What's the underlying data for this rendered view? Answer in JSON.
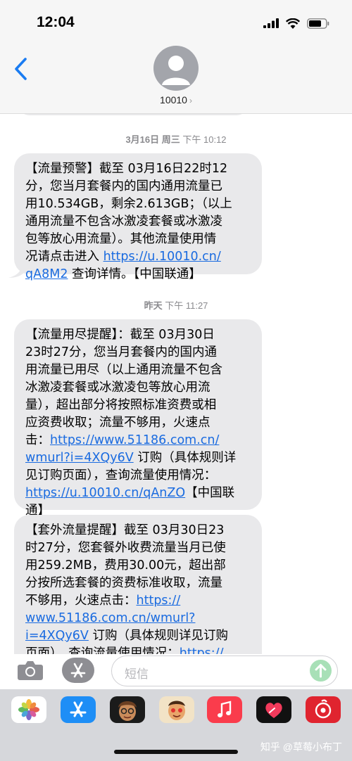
{
  "status_bar": {
    "time": "12:04"
  },
  "header": {
    "contact": "10010",
    "chevron": "›"
  },
  "thread": {
    "timestamps": [
      {
        "date": "3月16日 周三",
        "time": "下午 10:12"
      },
      {
        "date": "昨天",
        "time": "下午 11:27"
      }
    ],
    "messages": [
      {
        "lines": [
          "【流量预警】截至 03月16日22时12",
          "分，您当月套餐内的国内通用流量已",
          "用10.534GB，剩余2.613GB；（以上",
          "通用流量不包含冰激凌套餐或冰激凌",
          "包等放心用流量）。其他流量使用情",
          "况请点击进入 "
        ],
        "link1": "https://u.10010.cn/",
        "link2": "qA8M2",
        "tail_text": " 查询详情。【中国联通】"
      },
      {
        "lines": [
          "【流量用尽提醒】：截至 03月30日",
          "23时27分，您当月套餐内的国内通",
          "用流量已用尽（以上通用流量不包含",
          "冰激凌套餐或冰激凌包等放心用流",
          "量），超出部分将按照标准资费或相",
          "应资费收取；流量不够用，火速点",
          "击："
        ],
        "link1": "https://www.51186.com.cn/",
        "link2": "wmurl?i=4XQy6V",
        "after_link2": " 订购（具体规则详",
        "line9": "见订购页面），查询流量使用情况：",
        "link3": "https://u.10010.cn/qAnZO",
        "after_link3": "【中国联",
        "line11": "通】"
      },
      {
        "lines": [
          "【套外流量提醒】截至 03月30日23",
          "时27分，您套餐外收费流量当月已使",
          "用259.2MB，费用30.00元，超出部",
          "分按所选套餐的资费标准收取，流量",
          "不够用，火速点击："
        ],
        "link1": "https://",
        "link2": "www.51186.com.cn/wmurl?",
        "link3": "i=4XQy6V",
        "after_link3": " 订购（具体规则详见订购",
        "line9": "页面），查询流量使用情况：",
        "link4": "https://"
      }
    ]
  },
  "input_bar": {
    "placeholder": "短信"
  },
  "app_drawer": {
    "apps": [
      "photos-icon",
      "app-store-icon",
      "memoji-icon",
      "memoji-2-icon",
      "music-icon",
      "heart-icon",
      "netease-music-icon"
    ],
    "watermark": "知乎 @草莓小布丁"
  }
}
